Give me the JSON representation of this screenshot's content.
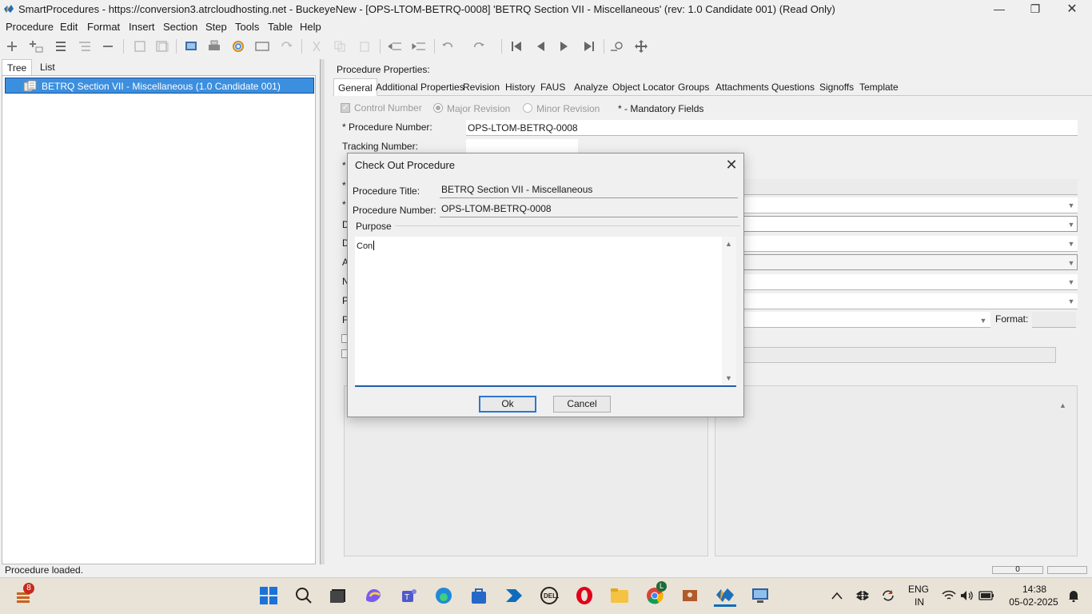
{
  "window": {
    "title": "SmartProcedures - https://conversion3.atrcloudhosting.net - BuckeyeNew - [OPS-LTOM-BETRQ-0008] 'BETRQ  Section VII - Miscellaneous' (rev: 1.0 Candidate 001) (Read Only)",
    "minimize": "—",
    "maximize": "❐",
    "close": "✕"
  },
  "menu": [
    "Procedure",
    "Edit",
    "Format",
    "Insert",
    "Section",
    "Step",
    "Tools",
    "Table",
    "Help"
  ],
  "left_tabs": [
    "Tree",
    "List"
  ],
  "tree": {
    "item_label": "BETRQ  Section VII - Miscellaneous (1.0 Candidate 001)"
  },
  "properties": {
    "heading": "Procedure Properties:",
    "tabs": [
      "General",
      "Additional Properties",
      "Revision",
      "History",
      "FAUS",
      "Analyze",
      "Object Locator",
      "Groups",
      "Attachments",
      "Questions",
      "Signoffs",
      "Template"
    ],
    "active_tab": "General",
    "control_number": "Control Number",
    "major_revision": "Major Revision",
    "minor_revision": "Minor Revision",
    "mandatory_note": "* - Mandatory Fields",
    "procedure_number_label": "* Procedure Number:",
    "procedure_number_value": "OPS-LTOM-BETRQ-0008",
    "tracking_number_label": "Tracking Number:",
    "format_label": "Format:",
    "partial_labels": [
      "*",
      "*",
      "*",
      "D",
      "D",
      "A",
      "N",
      "P",
      "F"
    ]
  },
  "dialog": {
    "title": "Check Out Procedure",
    "close": "✕",
    "procedure_title_label": "Procedure Title:",
    "procedure_title_value": "BETRQ  Section VII - Miscellaneous",
    "procedure_number_label": "Procedure Number:",
    "procedure_number_value": "OPS-LTOM-BETRQ-0008",
    "purpose_label": "Purpose",
    "purpose_value": "Con",
    "ok": "Ok",
    "cancel": "Cancel"
  },
  "status": {
    "text": "Procedure loaded.",
    "page": "0"
  },
  "taskbar": {
    "badge_count": "8",
    "chrome_badge": "L",
    "language": "ENG",
    "region": "IN",
    "time": "14:38",
    "date": "05-02-2025"
  }
}
